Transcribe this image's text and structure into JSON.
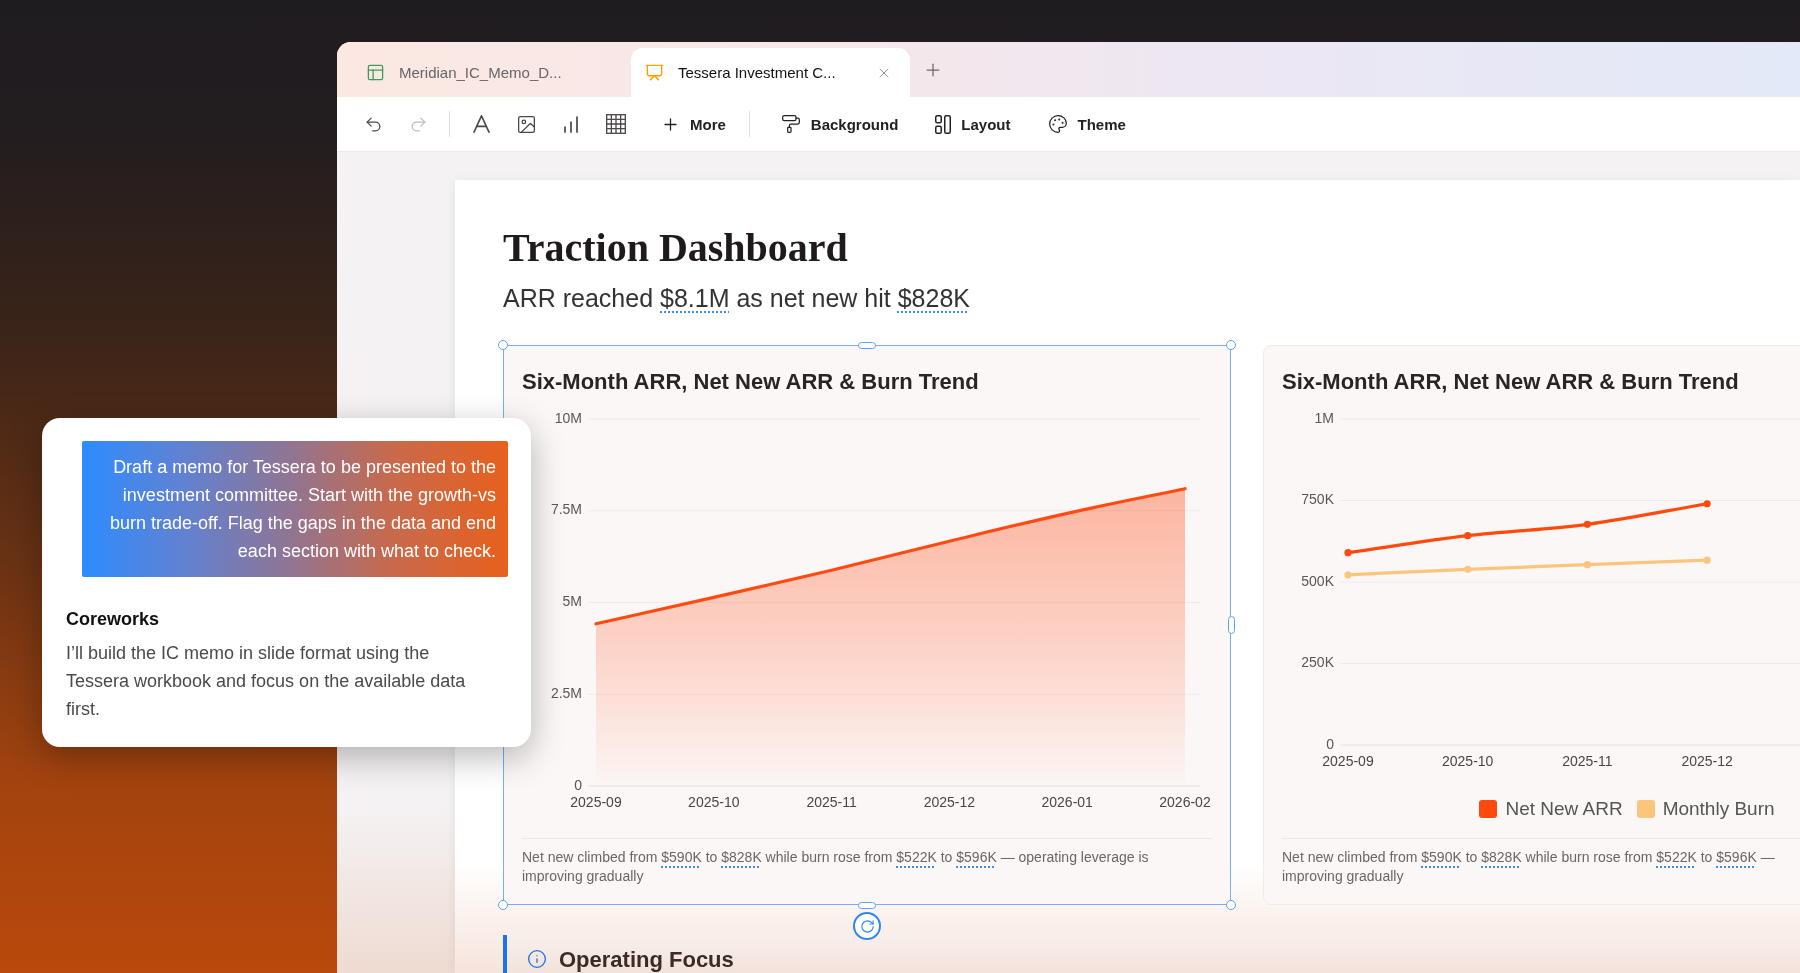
{
  "tabs": [
    {
      "title": "Meridian_IC_Memo_D...",
      "kind": "spreadsheet",
      "selected": false
    },
    {
      "title": "Tessera Investment C...",
      "kind": "presentation",
      "selected": true
    }
  ],
  "toolbar": {
    "undo": {
      "disabled": false
    },
    "redo": {
      "disabled": true
    },
    "buttons": [
      "More",
      "Background",
      "Layout",
      "Theme"
    ]
  },
  "slide": {
    "title": "Traction Dashboard",
    "subtitle": [
      {
        "kind": "text",
        "text": "ARR reached "
      },
      {
        "kind": "value",
        "text": "$8.1M"
      },
      {
        "kind": "text",
        "text": " as net new hit "
      },
      {
        "kind": "value",
        "text": "$828K"
      }
    ],
    "charts": [
      {
        "selected": true,
        "chart_data": {
          "type": "area",
          "title": "Six-Month ARR, Net New ARR & Burn Trend",
          "categories": [
            "2025-09",
            "2025-10",
            "2025-11",
            "2025-12",
            "2026-01",
            "2026-02"
          ],
          "series": [
            {
              "color": "#ff4a12",
              "values": [
                4420000,
                5140000,
                5880000,
                6670000,
                7430000,
                8100000
              ]
            }
          ],
          "ylim": [
            0,
            10000000
          ],
          "yticks": [
            {
              "value": 0,
              "label": "0"
            },
            {
              "value": 2500000,
              "label": "2.5M"
            },
            {
              "value": 5000000,
              "label": "5M"
            },
            {
              "value": 7500000,
              "label": "7.5M"
            },
            {
              "value": 10000000,
              "label": "10M"
            }
          ],
          "grid": true
        },
        "caption_lines": [
          [
            {
              "kind": "text",
              "text": "Net new climbed from "
            },
            {
              "kind": "value",
              "text": "$590K"
            },
            {
              "kind": "text",
              "text": " to "
            },
            {
              "kind": "value",
              "text": "$828K"
            },
            {
              "kind": "text",
              "text": " while burn rose from "
            },
            {
              "kind": "value",
              "text": "$522K"
            },
            {
              "kind": "text",
              "text": " to "
            },
            {
              "kind": "value",
              "text": "$596K"
            },
            {
              "kind": "text",
              "text": " — operating leverage is"
            }
          ],
          [
            {
              "kind": "text",
              "text": "improving gradually"
            }
          ]
        ]
      },
      {
        "selected": false,
        "chart_data": {
          "type": "line",
          "title": "Six-Month ARR, Net New ARR & Burn Trend",
          "categories": [
            "2025-09",
            "2025-10",
            "2025-11",
            "2025-12"
          ],
          "series": [
            {
              "name": "Net New ARR",
              "color": "#ff4a0d",
              "values": [
                590000,
                642000,
                677000,
                740000
              ],
              "marker": true
            },
            {
              "name": "Monthly Burn",
              "color": "#fdc47c",
              "values": [
                522000,
                539000,
                553000,
                567000
              ],
              "marker": true
            }
          ],
          "ylim": [
            0,
            1000000
          ],
          "yticks": [
            {
              "value": 0,
              "label": "0"
            },
            {
              "value": 250000,
              "label": "250K"
            },
            {
              "value": 500000,
              "label": "500K"
            },
            {
              "value": 750000,
              "label": "750K"
            },
            {
              "value": 1000000,
              "label": "1M"
            }
          ],
          "grid": true
        },
        "caption_lines": [
          [
            {
              "kind": "text",
              "text": "Net new climbed from "
            },
            {
              "kind": "value",
              "text": "$590K"
            },
            {
              "kind": "text",
              "text": " to "
            },
            {
              "kind": "value",
              "text": "$828K"
            },
            {
              "kind": "text",
              "text": " while burn rose from "
            },
            {
              "kind": "value",
              "text": "$522K"
            },
            {
              "kind": "text",
              "text": " to "
            },
            {
              "kind": "value",
              "text": "$596K"
            },
            {
              "kind": "text",
              "text": " —"
            }
          ],
          [
            {
              "kind": "text",
              "text": "improving gradually"
            }
          ]
        ]
      }
    ],
    "section": {
      "title": "Operating Focus"
    }
  },
  "chat": {
    "prompt": "Draft a memo for Tessera to be presented to the investment committee. Start with the growth-vs burn trade-off. Flag the gaps in the data and end each section with what to check.",
    "reply": {
      "author": "Coreworks",
      "text": "I’ll build the IC memo in slide format using the Tessera workbook and focus on the available data first."
    }
  }
}
